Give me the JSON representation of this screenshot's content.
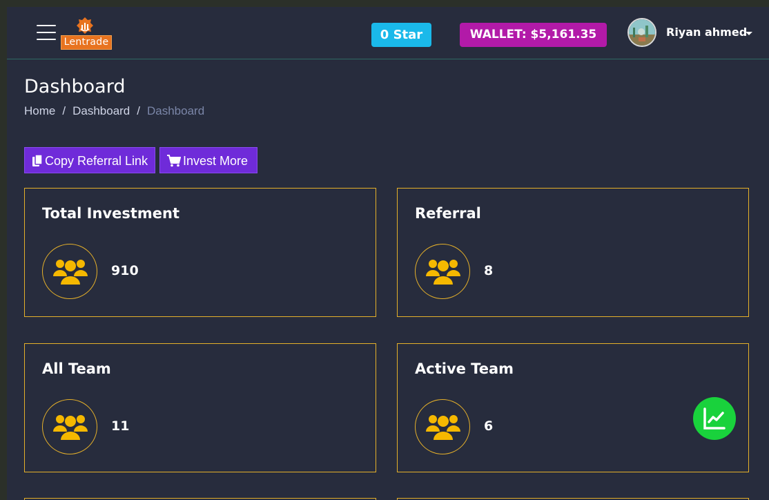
{
  "brand": {
    "name": "Lentrade"
  },
  "header": {
    "star_label": "0 Star",
    "wallet_label": "WALLET: $5,161.35",
    "user_name": "Riyan ahmed"
  },
  "page": {
    "title": "Dashboard",
    "breadcrumb": [
      {
        "label": "Home"
      },
      {
        "label": "Dashboard"
      },
      {
        "label": "Dashboard"
      }
    ]
  },
  "actions": {
    "copy_referral_label": "Copy Referral Link",
    "invest_more_label": "Invest More"
  },
  "cards": [
    {
      "title": "Total Investment",
      "value": "910",
      "icon": "users-icon"
    },
    {
      "title": "Referral",
      "value": "8",
      "icon": "users-icon"
    },
    {
      "title": "All Team",
      "value": "11",
      "icon": "users-icon"
    },
    {
      "title": "Active Team",
      "value": "6",
      "icon": "users-icon"
    }
  ],
  "colors": {
    "background": "#272c3d",
    "card_border": "#e6b12a",
    "icon_accent": "#f5b800",
    "star_badge": "#1ab9ea",
    "wallet_badge": "#b21aa8",
    "button": "#6f2bd9",
    "fab": "#19d23c",
    "logo": "#e8731f"
  },
  "icons": {
    "menu": "hamburger-menu-icon",
    "copy": "copy-icon",
    "cart": "shopping-cart-icon",
    "card": "users-icon",
    "fab": "line-chart-icon"
  }
}
